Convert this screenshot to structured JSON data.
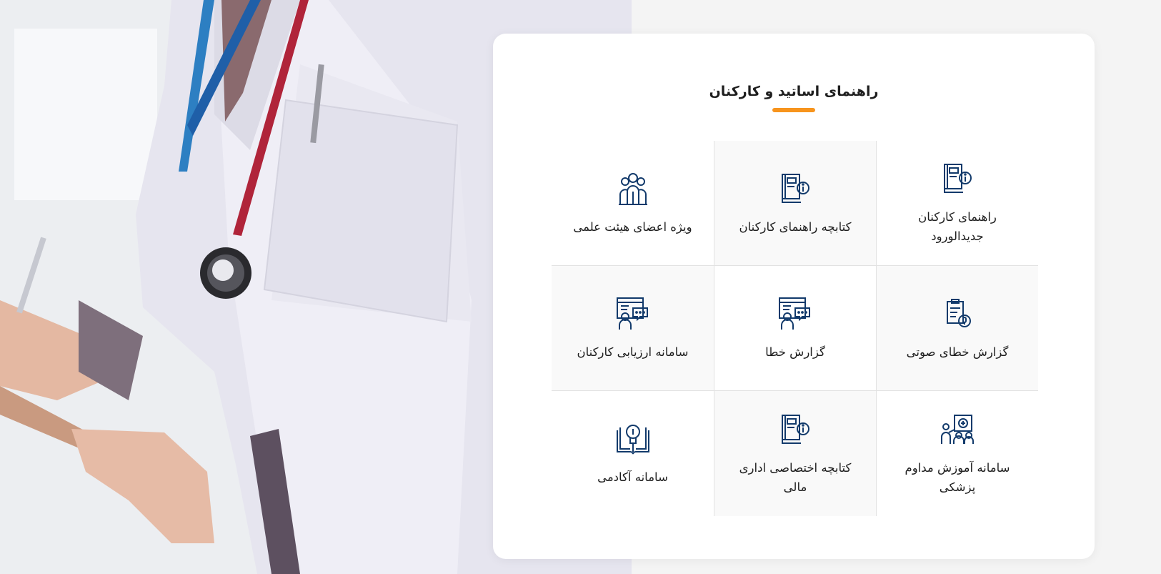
{
  "colors": {
    "accent": "#f7941d",
    "icon": "#123a6b"
  },
  "panel": {
    "title": "راهنمای اساتید و کارکنان",
    "items": [
      {
        "label": "راهنمای کارکنان جدیدالورود",
        "icon": "book-info-icon"
      },
      {
        "label": "کتابچه راهنمای کارکنان",
        "icon": "book-info-icon"
      },
      {
        "label": "ویژه اعضای هیئت علمی",
        "icon": "faculty-group-icon"
      },
      {
        "label": "گزارش خطای صوتی",
        "icon": "clipboard-mic-icon"
      },
      {
        "label": "گزارش خطا",
        "icon": "web-chat-report-icon"
      },
      {
        "label": "سامانه ارزیابی کارکنان",
        "icon": "web-chat-evaluation-icon"
      },
      {
        "label": "سامانه آموزش مداوم پزشکی",
        "icon": "medical-training-icon"
      },
      {
        "label": "کتابچه اختصاصی اداری مالی",
        "icon": "book-info-icon"
      },
      {
        "label": "سامانه آکادمی",
        "icon": "lightbulb-book-icon"
      }
    ]
  }
}
